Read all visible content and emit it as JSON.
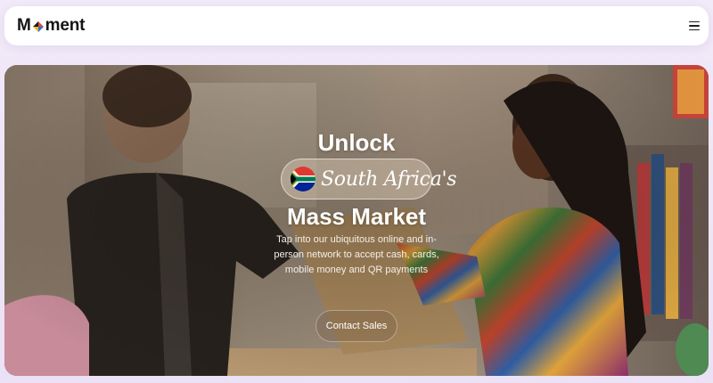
{
  "brand": {
    "logo_m": "M",
    "logo_rest": "ment",
    "logo_mark_colors": [
      "#e8473d",
      "#2f6fd6",
      "#f3b728"
    ]
  },
  "nav": {
    "menu_icon": "hamburger-menu-icon"
  },
  "hero": {
    "headline_line1": "Unlock",
    "country_label": "South Africa's",
    "country_flag_icon": "south-africa-flag-icon",
    "headline_line2": "Mass Market",
    "description": "Tap into our ubiquitous online and in-person network to accept cash, cards, mobile money and QR payments",
    "cta_label": "Contact Sales"
  },
  "colors": {
    "page_bg": "#efe7f7",
    "nav_bg": "#ffffff",
    "text_light": "#ffffff"
  }
}
